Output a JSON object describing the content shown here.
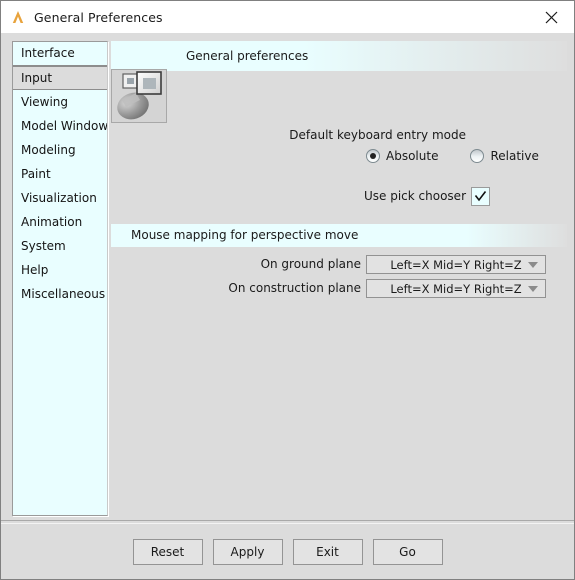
{
  "window": {
    "title": "General Preferences",
    "app_icon": "autodesk-a-icon",
    "app_icon_color": "#e8a33d",
    "close_label": "close-icon",
    "background_color": "#dcdcdc",
    "accent_panel_color": "#e9feff"
  },
  "sidebar": {
    "items": [
      {
        "label": "Interface",
        "selected": false
      },
      {
        "label": "Input",
        "selected": true
      },
      {
        "label": "Viewing",
        "selected": false
      },
      {
        "label": "Model Windows",
        "selected": false
      },
      {
        "label": "Modeling",
        "selected": false
      },
      {
        "label": "Paint",
        "selected": false
      },
      {
        "label": "Visualization",
        "selected": false
      },
      {
        "label": "Animation",
        "selected": false
      },
      {
        "label": "System",
        "selected": false
      },
      {
        "label": "Help",
        "selected": false
      },
      {
        "label": "Miscellaneous",
        "selected": false
      }
    ]
  },
  "panel": {
    "header_title": "General preferences",
    "header_icon": "mouse-and-windows-icon"
  },
  "form": {
    "keyboard_entry_label": "Default keyboard entry mode",
    "radios": [
      {
        "label": "Absolute",
        "selected": true
      },
      {
        "label": "Relative",
        "selected": false
      }
    ],
    "pick_chooser_label": "Use pick chooser",
    "pick_chooser_checked": true,
    "pick_chooser_check_glyph": "checkmark-icon"
  },
  "mouse_mapping": {
    "band_title": "Mouse mapping for perspective move",
    "fields": [
      {
        "label": "On ground plane",
        "value": "Left=X Mid=Y Right=Z"
      },
      {
        "label": "On construction plane",
        "value": "Left=X Mid=Y Right=Z"
      }
    ]
  },
  "footer": {
    "buttons": [
      {
        "label": "Reset"
      },
      {
        "label": "Apply"
      },
      {
        "label": "Exit"
      },
      {
        "label": "Go"
      }
    ]
  }
}
